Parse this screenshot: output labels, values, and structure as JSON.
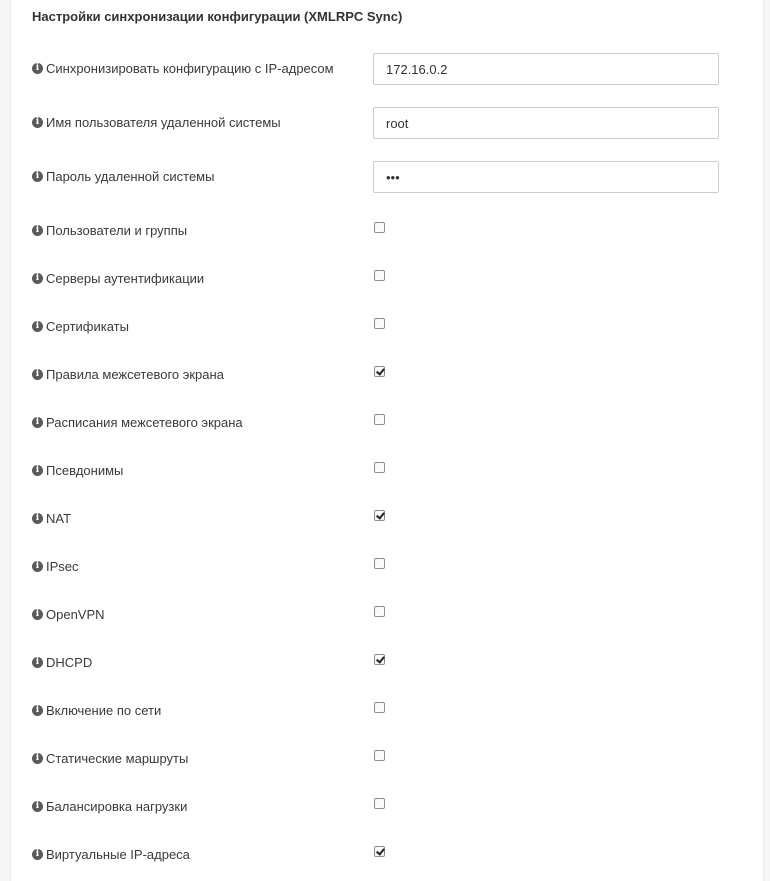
{
  "section": {
    "title": "Настройки синхронизации конфигурации (XMLRPC Sync)"
  },
  "fields": [
    {
      "label": "Синхронизировать конфигурацию с IP-адресом",
      "value": "172.16.0.2"
    },
    {
      "label": "Имя пользователя удаленной системы",
      "value": "root"
    },
    {
      "label": "Пароль удаленной системы",
      "value": "•••"
    }
  ],
  "checkboxes": [
    {
      "label": "Пользователи и группы",
      "checked": false
    },
    {
      "label": "Серверы аутентификации",
      "checked": false
    },
    {
      "label": "Сертификаты",
      "checked": false
    },
    {
      "label": "Правила межсетевого экрана",
      "checked": true
    },
    {
      "label": "Расписания межсетевого экрана",
      "checked": false
    },
    {
      "label": "Псевдонимы",
      "checked": false
    },
    {
      "label": "NAT",
      "checked": true
    },
    {
      "label": "IPsec",
      "checked": false
    },
    {
      "label": "OpenVPN",
      "checked": false
    },
    {
      "label": "DHCPD",
      "checked": true
    },
    {
      "label": "Включение по сети",
      "checked": false
    },
    {
      "label": "Статические маршруты",
      "checked": false
    },
    {
      "label": "Балансировка нагрузки",
      "checked": false
    },
    {
      "label": "Виртуальные IP-адреса",
      "checked": true
    }
  ],
  "icons": {
    "info": "info-circle-icon",
    "info_glyph": "i"
  }
}
